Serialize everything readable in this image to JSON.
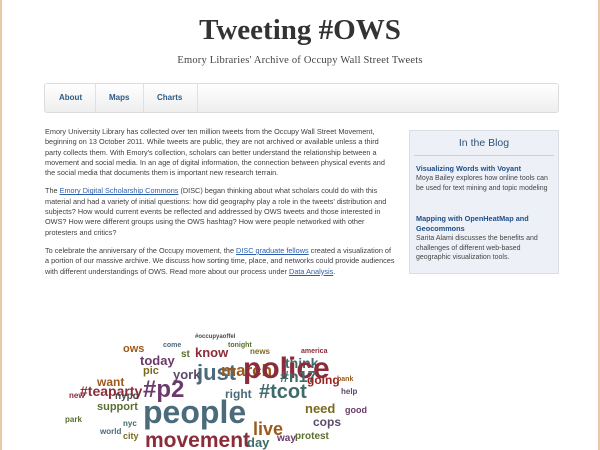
{
  "header": {
    "title": "Tweeting #OWS",
    "subtitle": "Emory Libraries' Archive of Occupy Wall Street Tweets"
  },
  "nav": {
    "items": [
      {
        "label": "About"
      },
      {
        "label": "Maps"
      },
      {
        "label": "Charts"
      }
    ]
  },
  "main": {
    "p1": "Emory University Library has collected over ten million tweets from the Occupy Wall Street Movement, beginning on 13 October 2011. While tweets are public, they are not archived or available unless a third party collects them. With Emory's collection, scholars can better understand the relationship between a movement and social media. In an age of digital information, the connection between physical events and the social media that documents them is important new research terrain.",
    "p2_pre": "The ",
    "p2_link": "Emory Digital Scholarship Commons",
    "p2_post": " (DISC) began thinking about what scholars could do with this material and had a variety of initial questions: how did geography play a role in the tweets' distribution and subjects? How would current events be reflected and addressed by OWS tweets and those interested in OWS? How were different groups using the OWS hashtag? How were people networked with other protesters and critics?",
    "p3_pre": "To celebrate the anniversary of the Occupy movement, the ",
    "p3_link": "DISC graduate fellows",
    "p3_mid": " created a visualization of a portion of our massive archive. We discuss how sorting time, place, and networks could provide audiences with different understandings of OWS. Read more about our process under ",
    "p3_link2": "Data Analysis",
    "p3_end": "."
  },
  "sidebar": {
    "title": "In the Blog",
    "posts": [
      {
        "title": "Visualizing Words with Voyant",
        "excerpt": "Moya Bailey explores how online tools can be used for text mining and topic modeling"
      },
      {
        "title": "Mapping with OpenHeatMap and Geocommons",
        "excerpt": "Sarita Alami discusses the benefits and challenges of different web-based geographic visualization tools."
      }
    ]
  },
  "wordcloud": {
    "words": [
      {
        "text": "#occupyaoffel",
        "color": "#4a4a4a"
      },
      {
        "text": "tonight",
        "color": "#5a6e30"
      },
      {
        "text": "america",
        "color": "#8b2c3a"
      },
      {
        "text": "come",
        "color": "#4b6a7a"
      },
      {
        "text": "ows",
        "color": "#9b5a1c"
      },
      {
        "text": "news",
        "color": "#7a6a20"
      },
      {
        "text": "think",
        "color": "#3f6b6b"
      },
      {
        "text": "know",
        "color": "#8b2c3a"
      },
      {
        "text": "st",
        "color": "#5a6e30"
      },
      {
        "text": "today",
        "color": "#6b3a6b"
      },
      {
        "text": "just",
        "color": "#4b6a7a"
      },
      {
        "text": "march",
        "color": "#9b5a1c"
      },
      {
        "text": "police",
        "color": "#8b2c3a"
      },
      {
        "text": "#n17",
        "color": "#3f6b6b"
      },
      {
        "text": "going",
        "color": "#9b2020"
      },
      {
        "text": "pic",
        "color": "#7a6a20"
      },
      {
        "text": "york",
        "color": "#5a4a6b"
      },
      {
        "text": "right",
        "color": "#4b6a7a"
      },
      {
        "text": "#p2",
        "color": "#6b3a6b"
      },
      {
        "text": "want",
        "color": "#9b5a1c"
      },
      {
        "text": "#teaparty",
        "color": "#8b2c3a"
      },
      {
        "text": "#tcot",
        "color": "#3f6b6b"
      },
      {
        "text": "support",
        "color": "#5a6e30"
      },
      {
        "text": "people",
        "color": "#4b6a7a"
      },
      {
        "text": "need",
        "color": "#7a6a20"
      },
      {
        "text": "cops",
        "color": "#5a4a6b"
      },
      {
        "text": "movement",
        "color": "#8b2c3a"
      },
      {
        "text": "live",
        "color": "#9b5a1c"
      },
      {
        "text": "day",
        "color": "#3f6b6b"
      },
      {
        "text": "way",
        "color": "#6b3a6b"
      },
      {
        "text": "protest",
        "color": "#5a6e30"
      },
      {
        "text": "world",
        "color": "#4b6a7a"
      },
      {
        "text": "city",
        "color": "#7a6a20"
      },
      {
        "text": "nypd",
        "color": "#4a4a4a"
      },
      {
        "text": "good",
        "color": "#6b3a6b"
      },
      {
        "text": "bank",
        "color": "#9b5a1c"
      },
      {
        "text": "help",
        "color": "#5a4a6b"
      },
      {
        "text": "new",
        "color": "#8b2c3a"
      },
      {
        "text": "nyc",
        "color": "#3f6b6b"
      },
      {
        "text": "park",
        "color": "#5a6e30"
      }
    ]
  }
}
